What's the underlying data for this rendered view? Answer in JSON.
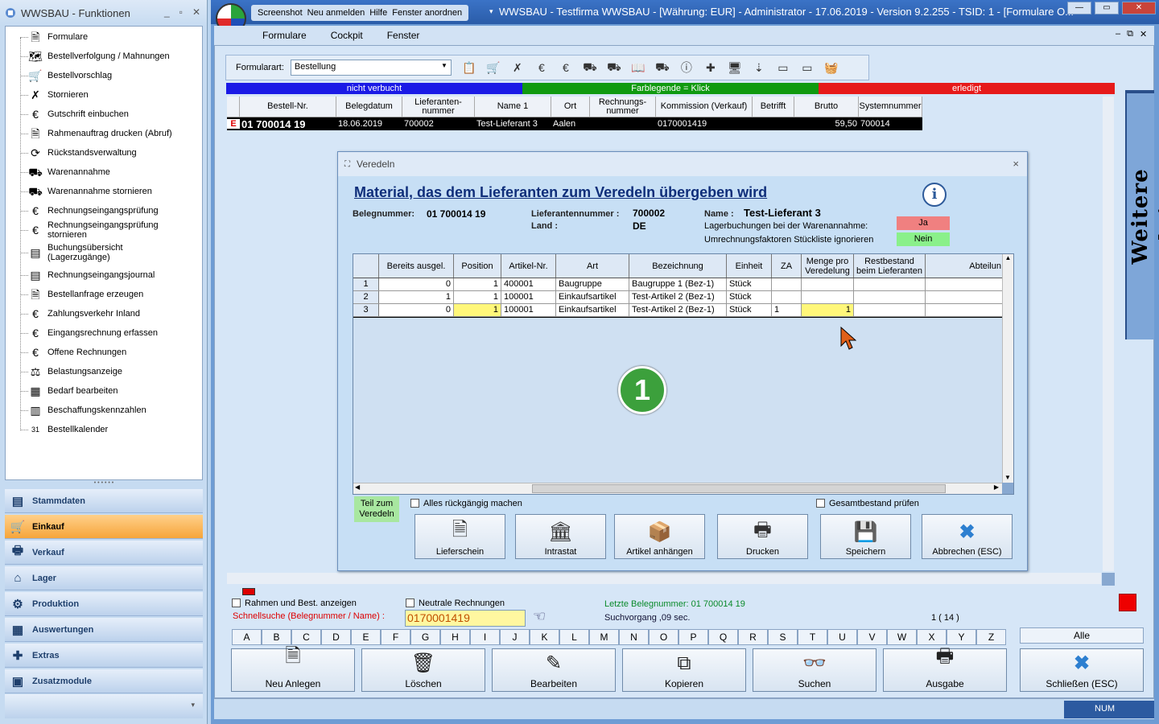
{
  "left_panel": {
    "title": "WWSBAU - Funktionen",
    "controls": [
      "_",
      "▫",
      "✕"
    ],
    "items": [
      "Formulare",
      "Bestellverfolgung / Mahnungen",
      "Bestellvorschlag",
      "Stornieren",
      "Gutschrift einbuchen",
      "Rahmenauftrag drucken (Abruf)",
      "Rückstandsverwaltung",
      "Warenannahme",
      "Warenannahme stornieren",
      "Rechnungseingangsprüfung",
      "Rechnungseingangsprüfung stornieren",
      "Buchungsübersicht (Lagerzugänge)",
      "Rechnungseingangsjournal",
      "Bestellanfrage erzeugen",
      "Zahlungsverkehr Inland",
      "Eingangsrechnung erfassen",
      "Offene Rechnungen",
      "Belastungsanzeige",
      "Bedarf bearbeiten",
      "Beschaffungskennzahlen",
      "Bestellkalender"
    ],
    "nav": [
      "Stammdaten",
      "Einkauf",
      "Verkauf",
      "Lager",
      "Produktion",
      "Auswertungen",
      "Extras",
      "Zusatzmodule"
    ],
    "active_nav": "Einkauf"
  },
  "titlebar": {
    "quick": [
      "Screenshot",
      "Neu anmelden",
      "Hilfe",
      "Fenster anordnen"
    ],
    "text": "WWSBAU - Testfirma WWSBAU - [Währung: EUR] - Administrator - 17.06.2019 - Version 9.2.255 - TSID: 1 - [Formulare O...",
    "controls": [
      "—",
      "▭",
      "✕"
    ]
  },
  "menu": [
    "Formulare",
    "Cockpit",
    "Fenster"
  ],
  "mdi_controls": [
    "–",
    "⧉",
    "✕"
  ],
  "toolbar": {
    "label": "Formularart:",
    "value": "Bestellung"
  },
  "legend": [
    {
      "text": "nicht verbucht",
      "color": "#1a1ae6"
    },
    {
      "text": "Farblegende = Klick",
      "color": "#109a10"
    },
    {
      "text": "erledigt",
      "color": "#e61a1a"
    }
  ],
  "orders": {
    "headers": [
      "Bestell-Nr.",
      "Belegdatum",
      "Lieferanten-\nnummer",
      "Name 1",
      "Ort",
      "Rechnungs-\nnummer",
      "Kommission (Verkauf)",
      "Betrifft",
      "Brutto",
      "Systemnummer"
    ],
    "row": {
      "marker": "E",
      "cells": [
        "01 700014 19",
        "18.06.2019",
        "700002",
        "Test-Lieferant 3",
        "Aalen",
        "",
        "0170001419",
        "",
        "59,50",
        "700014"
      ]
    }
  },
  "dialog": {
    "title": "Veredeln",
    "close": "×",
    "heading": "Material, das dem Lieferanten zum Veredeln übergeben wird",
    "info_icon": "i",
    "belegnummer_label": "Belegnummer:",
    "belegnummer": "01 700014 19",
    "lieferant_label": "Lieferantennummer :",
    "lieferant": "700002",
    "land_label": "Land :",
    "land": "DE",
    "name_label": "Name :",
    "name": "Test-Lieferant 3",
    "lager_label": "Lagerbuchungen bei der Warenannahme:",
    "lager_value": "Ja",
    "umr_label": "Umrechnungsfaktoren Stückliste ignorieren",
    "umr_value": "Nein",
    "table_headers": [
      "",
      "Bereits ausgel.",
      "Position",
      "Artikel-Nr.",
      "Art",
      "Bezeichnung",
      "Einheit",
      "ZA",
      "Menge pro\nVeredelung",
      "Restbestand\nbeim Lieferanten",
      "Abteilun"
    ],
    "rows": [
      [
        "1",
        "0",
        "1",
        "400001",
        "Baugruppe",
        "Baugruppe 1  (Bez-1)",
        "Stück",
        "",
        "",
        ""
      ],
      [
        "2",
        "1",
        "1",
        "100001",
        "Einkaufsartikel",
        "Test-Artikel 2  (Bez-1)",
        "Stück",
        "",
        "",
        ""
      ],
      [
        "3",
        "0",
        "1",
        "100001",
        "Einkaufsartikel",
        "Test-Artikel 2  (Bez-1)",
        "Stück",
        "1",
        "1",
        ""
      ]
    ],
    "marker": "1",
    "teil_label": "Teil zum Veredeln",
    "undo_label": "Alles rückgängig machen",
    "gesamt_label": "Gesamtbestand prüfen",
    "buttons": [
      "Lieferschein",
      "Intrastat",
      "Artikel anhängen",
      "Drucken",
      "Speichern",
      "Abbrechen (ESC)"
    ]
  },
  "side_label": "Weitere Funktionen",
  "bottom": {
    "rahmen_label": "Rahmen und Best. anzeigen",
    "neutrale_label": "Neutrale Rechnungen",
    "schnell_label": "Schnellsuche (Belegnummer / Name) :",
    "search_value": "0170001419",
    "letzte": "Letzte Belegnummer: 01 700014 19",
    "such": "Suchvorgang ,09 sec.",
    "count": "1  ( 14 )",
    "alle": "Alle",
    "letters": [
      "A",
      "B",
      "C",
      "D",
      "E",
      "F",
      "G",
      "H",
      "I",
      "J",
      "K",
      "L",
      "M",
      "N",
      "O",
      "P",
      "Q",
      "R",
      "S",
      "T",
      "U",
      "V",
      "W",
      "X",
      "Y",
      "Z"
    ],
    "buttons": [
      "Neu Anlegen",
      "Löschen",
      "Bearbeiten",
      "Kopieren",
      "Suchen",
      "Ausgabe"
    ],
    "close": "Schließen (ESC)"
  },
  "status": {
    "num": "NUM"
  }
}
